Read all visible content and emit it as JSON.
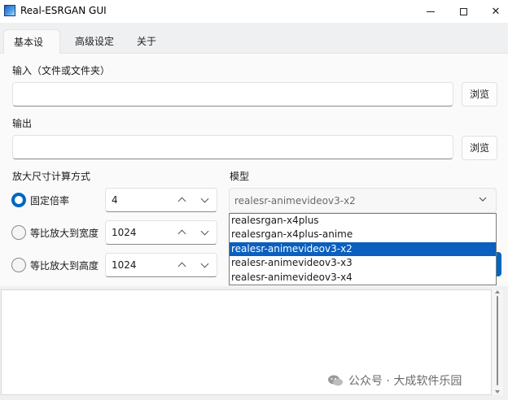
{
  "window": {
    "title": "Real-ESRGAN GUI"
  },
  "tabs": [
    {
      "label": "基本设定"
    },
    {
      "label": "高级设定"
    },
    {
      "label": "关于"
    }
  ],
  "input": {
    "label": "输入（文件或文件夹）",
    "value": "",
    "browse": "浏览"
  },
  "output": {
    "label": "输出",
    "value": "",
    "browse": "浏览"
  },
  "scale": {
    "label": "放大尺寸计算方式",
    "options": [
      {
        "label": "固定倍率",
        "value": "4",
        "selected": true
      },
      {
        "label": "等比放大到宽度",
        "value": "1024",
        "selected": false
      },
      {
        "label": "等比放大到高度",
        "value": "1024",
        "selected": false
      }
    ]
  },
  "model": {
    "label": "模型",
    "selected": "realesr-animevideov3-x2",
    "options": [
      "realesrgan-x4plus",
      "realesrgan-x4plus-anime",
      "realesr-animevideov3-x2",
      "realesr-animevideov3-x3",
      "realesr-animevideov3-x4"
    ],
    "highlighted_index": 2
  },
  "log": {
    "text": ""
  },
  "watermark": {
    "text": "公众号 · 大成软件乐园"
  },
  "colors": {
    "accent": "#0067c0",
    "highlight": "#0a5fbf"
  },
  "icons": [
    "app-icon",
    "minimize-icon",
    "maximize-icon",
    "close-icon",
    "chevron-up-icon",
    "chevron-down-icon",
    "wechat-icon"
  ]
}
